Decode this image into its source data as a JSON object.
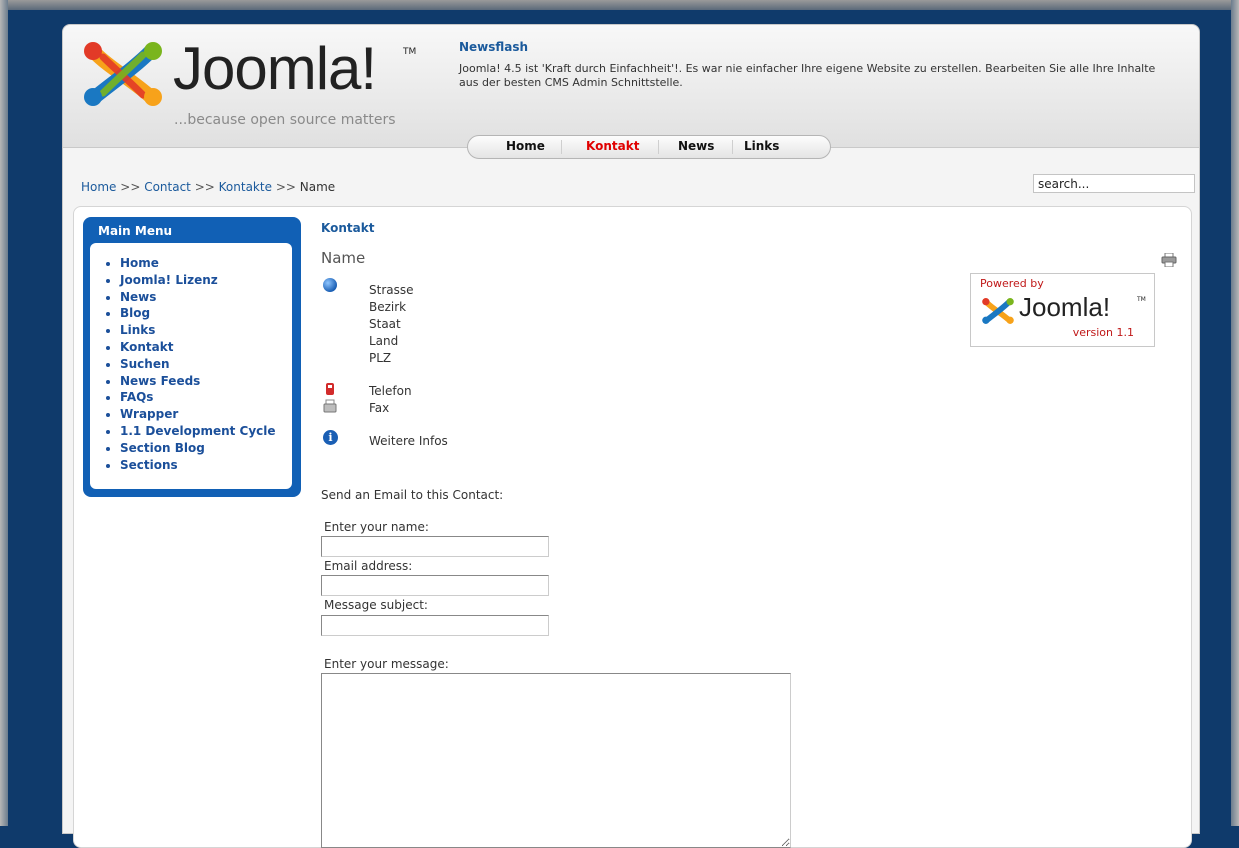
{
  "header": {
    "logo_text": "Joomla!",
    "logo_tm": "TM",
    "logo_tagline": "...because open source matters",
    "newsflash_title": "Newsflash",
    "newsflash_text": "Joomla! 4.5 ist 'Kraft durch Einfachheit'!. Es war nie einfacher Ihre eigene Website zu erstellen. Bearbeiten Sie alle Ihre Inhalte aus der besten CMS Admin Schnittstelle."
  },
  "topnav": {
    "items": [
      "Home",
      "Kontakt",
      "News",
      "Links"
    ],
    "active": "Kontakt"
  },
  "breadcrumb": {
    "items": [
      "Home",
      "Contact",
      "Kontakte",
      "Name"
    ],
    "separator": ">>"
  },
  "search": {
    "value": "search..."
  },
  "mainmenu": {
    "title": "Main Menu",
    "items": [
      "Home",
      "Joomla! Lizenz",
      "News",
      "Blog",
      "Links",
      "Kontakt",
      "Suchen",
      "News Feeds",
      "FAQs",
      "Wrapper",
      "1.1 Development Cycle",
      "Section Blog",
      "Sections"
    ]
  },
  "contact": {
    "section_title": "Kontakt",
    "name": "Name",
    "address": [
      "Strasse",
      "Bezirk",
      "Staat",
      "Land",
      "PLZ"
    ],
    "telefon": "Telefon",
    "fax": "Fax",
    "weitere_infos": "Weitere Infos"
  },
  "form": {
    "intro": "Send an Email to this Contact:",
    "name_label": "Enter your name:",
    "email_label": "Email address:",
    "subject_label": "Message subject:",
    "message_label": "Enter your message:"
  },
  "powered": {
    "by": "Powered by",
    "brand": "Joomla!",
    "tm": "TM",
    "version": "version 1.1"
  },
  "colors": {
    "page_background": "#0f3a6b",
    "menu_blue": "#1160b5",
    "link_blue": "#1b5a9c",
    "active_red": "#e00000"
  },
  "icons": [
    "joomla-logo-icon",
    "print-icon",
    "globe-icon",
    "phone-icon",
    "fax-icon",
    "info-icon"
  ]
}
